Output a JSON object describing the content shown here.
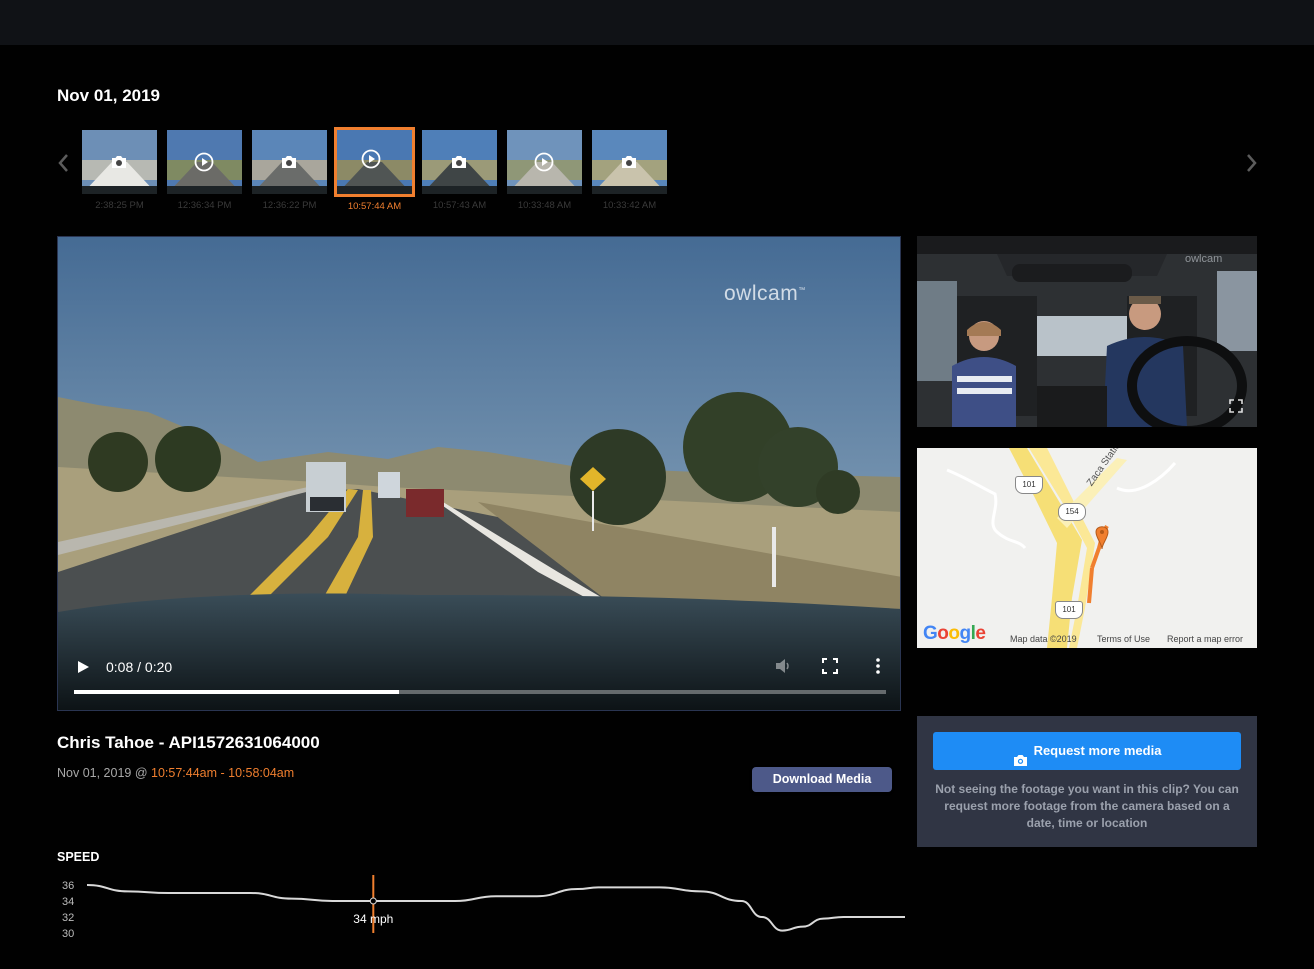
{
  "header": {
    "date": "Nov 01, 2019"
  },
  "timeline": {
    "prev_icon": "chevron-left-icon",
    "next_icon": "chevron-right-icon",
    "thumbnails": [
      {
        "type": "photo",
        "time": "2:38:25 PM",
        "active": false
      },
      {
        "type": "video",
        "time": "12:36:34 PM",
        "active": false
      },
      {
        "type": "photo",
        "time": "12:36:22 PM",
        "active": false
      },
      {
        "type": "video",
        "time": "10:57:44 AM",
        "active": true
      },
      {
        "type": "photo",
        "time": "10:57:43 AM",
        "active": false
      },
      {
        "type": "video",
        "time": "10:33:48 AM",
        "active": false
      },
      {
        "type": "photo",
        "time": "10:33:42 AM",
        "active": false
      }
    ]
  },
  "player": {
    "watermark": "owlcam",
    "time_display": "0:08 / 0:20",
    "progress": 0.4,
    "icons": [
      "play-icon",
      "volume-icon",
      "fullscreen-icon",
      "more-vert-icon"
    ]
  },
  "cabin_cam": {
    "watermark": "owlcam",
    "icon": "fullscreen-icon"
  },
  "map": {
    "labels": {
      "road_a": "Zaca Station Rd",
      "shield_101_top": "101",
      "shield_154": "154",
      "shield_101_bottom": "101"
    },
    "footer": {
      "logo": "Google",
      "data": "Map data ©2019",
      "terms": "Terms of Use",
      "report": "Report a map error"
    }
  },
  "clip": {
    "title": "Chris Tahoe - API1572631064000",
    "date": "Nov 01, 2019 @ ",
    "range": "10:57:44am - 10:58:04am",
    "download_label": "Download Media"
  },
  "request": {
    "button_label": "Request more media",
    "icon": "camera-icon",
    "note": "Not seeing the footage you want in this clip? You can request more footage from the camera based on a date, time or location"
  },
  "speed": {
    "title": "SPEED",
    "current_label": "34 mph",
    "accent": "#f07f2f",
    "chart_data": {
      "type": "line",
      "yticks": [
        "36",
        "34",
        "32",
        "30"
      ],
      "ylim": [
        30,
        36
      ],
      "xlim": [
        0,
        20
      ],
      "current_x": 7,
      "series": [
        {
          "values_x": [
            0,
            1,
            2,
            3,
            4,
            5,
            6,
            7,
            8,
            9,
            10,
            11,
            12,
            12.5,
            13,
            14,
            15,
            16,
            16.5,
            17,
            17.5,
            18,
            18.5,
            19,
            20
          ],
          "values_y": [
            36,
            35.2,
            35,
            35,
            35,
            34.3,
            34,
            34,
            34,
            34,
            34.6,
            34.6,
            35.5,
            35.7,
            35.7,
            35.7,
            35.2,
            34,
            32,
            30.3,
            30.8,
            31.8,
            32,
            32,
            32
          ]
        }
      ]
    }
  }
}
